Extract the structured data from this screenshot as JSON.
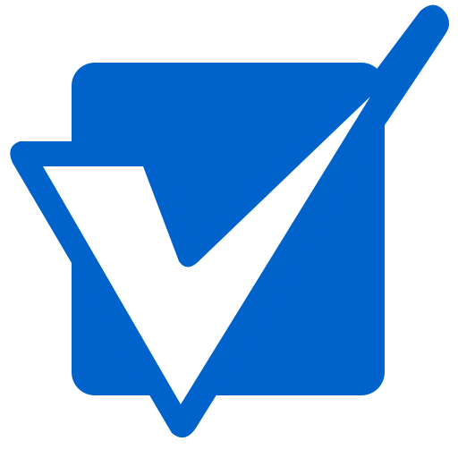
{
  "icon": {
    "name": "checkbox-checkmark-icon",
    "colors": {
      "primary": "#0063CC",
      "accent": "#FFFFFF",
      "background": "#FFFFFF"
    }
  }
}
